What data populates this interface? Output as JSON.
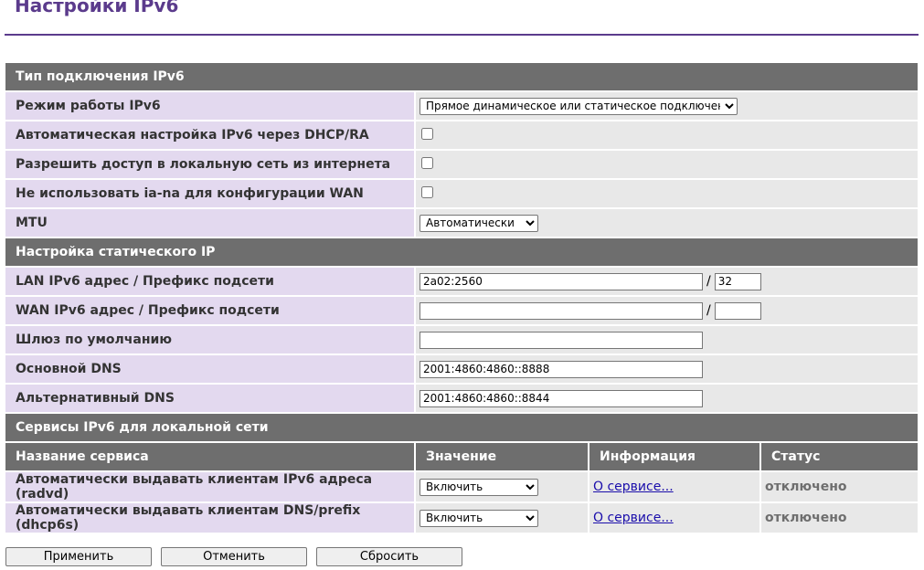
{
  "page": {
    "title": "Настройки IPv6"
  },
  "connection": {
    "header": "Тип подключения IPv6",
    "rows": {
      "mode_label": "Режим работы IPv6",
      "mode_value": "Прямое динамическое или статическое подключение",
      "auto_label": "Автоматическая настройка IPv6 через DHCP/RA",
      "auto_checked": false,
      "access_label": "Разрешить доступ в локальную сеть из интернета",
      "access_checked": false,
      "iana_label": "Не использовать ia-na для конфигурации WAN",
      "iana_checked": false,
      "mtu_label": "MTU",
      "mtu_value": "Автоматически"
    }
  },
  "static": {
    "header": "Настройка статического IP",
    "lan_label": "LAN IPv6 адрес / Префикс подсети",
    "lan_address": "2a02:2560",
    "lan_prefix": "32",
    "wan_label": "WAN IPv6 адрес / Префикс подсети",
    "wan_address": "",
    "wan_prefix": "",
    "gateway_label": "Шлюз по умолчанию",
    "gateway_value": "",
    "dns1_label": "Основной DNS",
    "dns1_value": "2001:4860:4860::8888",
    "dns2_label": "Альтернативный DNS",
    "dns2_value": "2001:4860:4860::8844",
    "slash": "/"
  },
  "services": {
    "header": "Сервисы IPv6 для локальной сети",
    "columns": [
      "Название сервиса",
      "Значение",
      "Информация",
      "Статус"
    ],
    "rows": [
      {
        "name": "Автоматически выдавать клиентам IPv6 адреса (radvd)",
        "value": "Включить",
        "info": "О сервисе...",
        "status": "отключено"
      },
      {
        "name": "Автоматически выдавать клиентам DNS/prefix (dhcp6s)",
        "value": "Включить",
        "info": "О сервисе...",
        "status": "отключено"
      }
    ]
  },
  "buttons": {
    "apply": "Применить",
    "cancel": "Отменить",
    "reset": "Сбросить"
  },
  "colors": {
    "accent": "#5b3b8c",
    "header_bg": "#6e6e6e",
    "label_bg": "#e3d9ef",
    "value_bg": "#e8e8e8"
  }
}
